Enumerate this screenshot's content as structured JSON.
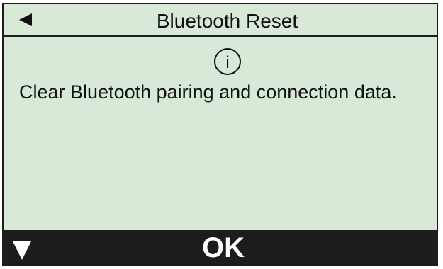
{
  "header": {
    "title": "Bluetooth Reset",
    "back_icon": "left-triangle-icon"
  },
  "info": {
    "icon": "info-icon",
    "glyph": "i"
  },
  "message": {
    "text": "Clear Bluetooth pairing and connection data."
  },
  "footer": {
    "down_icon": "down-triangle-icon",
    "ok_label": "OK"
  },
  "colors": {
    "screen_background": "#d8e9d8",
    "bar_background": "#1c1c1c",
    "text": "#111111",
    "footer_text": "#ffffff"
  }
}
